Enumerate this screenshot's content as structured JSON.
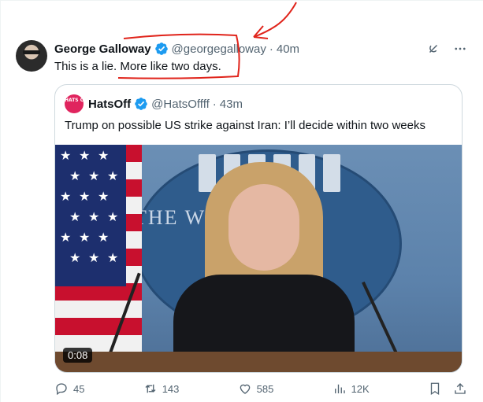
{
  "author": {
    "name": "George Galloway",
    "handle": "@georgegalloway",
    "dot": "·",
    "time": "40m"
  },
  "tweet": {
    "text": "This is a lie. More like two days."
  },
  "quote": {
    "avatar_text": "HATS OFF",
    "name": "HatsOff",
    "handle": "@HatsOffff",
    "dot": "·",
    "time": "43m",
    "text": "Trump on possible US strike against Iran: I’ll decide within two weeks",
    "media": {
      "overlay_text": "THE W      OUSE",
      "duration": "0:08"
    }
  },
  "actions": {
    "replies": "45",
    "reposts": "143",
    "likes": "585",
    "views": "12K"
  },
  "colors": {
    "verified": "#1d9bf0",
    "annotation": "#e0241b",
    "muted": "#536471"
  },
  "icons": [
    "verified-badge-icon",
    "grok-icon",
    "more-icon",
    "reply-icon",
    "repost-icon",
    "like-icon",
    "views-icon",
    "bookmark-icon",
    "share-icon"
  ]
}
